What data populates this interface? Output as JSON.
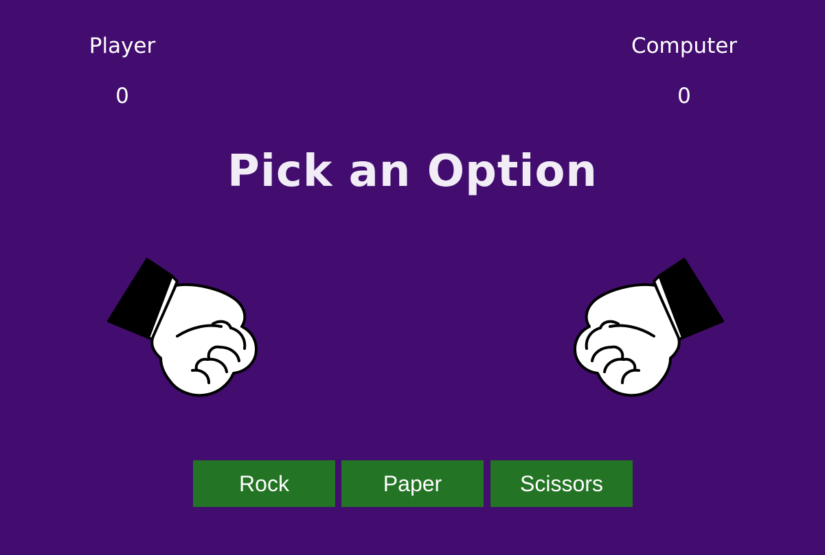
{
  "scoreboard": {
    "player_label": "Player",
    "player_score": "0",
    "computer_label": "Computer",
    "computer_score": "0"
  },
  "message": "Pick an Option",
  "hands": {
    "player": "fist-icon",
    "computer": "fist-icon"
  },
  "buttons": {
    "rock": "Rock",
    "paper": "Paper",
    "scissors": "Scissors"
  },
  "colors": {
    "background": "#420d6e",
    "button": "#247425",
    "text": "#ffffff"
  }
}
